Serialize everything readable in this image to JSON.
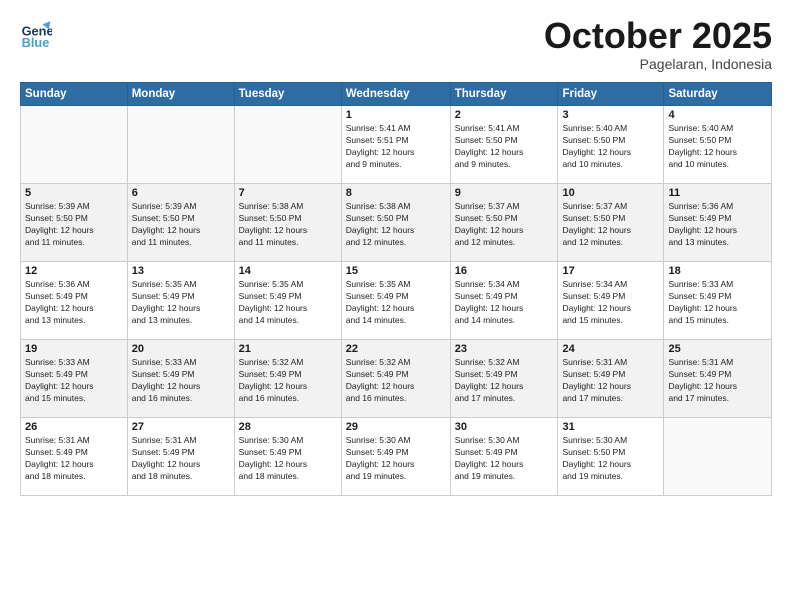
{
  "header": {
    "logo_general": "General",
    "logo_blue": "Blue",
    "month": "October 2025",
    "location": "Pagelaran, Indonesia"
  },
  "weekdays": [
    "Sunday",
    "Monday",
    "Tuesday",
    "Wednesday",
    "Thursday",
    "Friday",
    "Saturday"
  ],
  "weeks": [
    [
      {
        "day": "",
        "info": ""
      },
      {
        "day": "",
        "info": ""
      },
      {
        "day": "",
        "info": ""
      },
      {
        "day": "1",
        "info": "Sunrise: 5:41 AM\nSunset: 5:51 PM\nDaylight: 12 hours\nand 9 minutes."
      },
      {
        "day": "2",
        "info": "Sunrise: 5:41 AM\nSunset: 5:50 PM\nDaylight: 12 hours\nand 9 minutes."
      },
      {
        "day": "3",
        "info": "Sunrise: 5:40 AM\nSunset: 5:50 PM\nDaylight: 12 hours\nand 10 minutes."
      },
      {
        "day": "4",
        "info": "Sunrise: 5:40 AM\nSunset: 5:50 PM\nDaylight: 12 hours\nand 10 minutes."
      }
    ],
    [
      {
        "day": "5",
        "info": "Sunrise: 5:39 AM\nSunset: 5:50 PM\nDaylight: 12 hours\nand 11 minutes."
      },
      {
        "day": "6",
        "info": "Sunrise: 5:39 AM\nSunset: 5:50 PM\nDaylight: 12 hours\nand 11 minutes."
      },
      {
        "day": "7",
        "info": "Sunrise: 5:38 AM\nSunset: 5:50 PM\nDaylight: 12 hours\nand 11 minutes."
      },
      {
        "day": "8",
        "info": "Sunrise: 5:38 AM\nSunset: 5:50 PM\nDaylight: 12 hours\nand 12 minutes."
      },
      {
        "day": "9",
        "info": "Sunrise: 5:37 AM\nSunset: 5:50 PM\nDaylight: 12 hours\nand 12 minutes."
      },
      {
        "day": "10",
        "info": "Sunrise: 5:37 AM\nSunset: 5:50 PM\nDaylight: 12 hours\nand 12 minutes."
      },
      {
        "day": "11",
        "info": "Sunrise: 5:36 AM\nSunset: 5:49 PM\nDaylight: 12 hours\nand 13 minutes."
      }
    ],
    [
      {
        "day": "12",
        "info": "Sunrise: 5:36 AM\nSunset: 5:49 PM\nDaylight: 12 hours\nand 13 minutes."
      },
      {
        "day": "13",
        "info": "Sunrise: 5:35 AM\nSunset: 5:49 PM\nDaylight: 12 hours\nand 13 minutes."
      },
      {
        "day": "14",
        "info": "Sunrise: 5:35 AM\nSunset: 5:49 PM\nDaylight: 12 hours\nand 14 minutes."
      },
      {
        "day": "15",
        "info": "Sunrise: 5:35 AM\nSunset: 5:49 PM\nDaylight: 12 hours\nand 14 minutes."
      },
      {
        "day": "16",
        "info": "Sunrise: 5:34 AM\nSunset: 5:49 PM\nDaylight: 12 hours\nand 14 minutes."
      },
      {
        "day": "17",
        "info": "Sunrise: 5:34 AM\nSunset: 5:49 PM\nDaylight: 12 hours\nand 15 minutes."
      },
      {
        "day": "18",
        "info": "Sunrise: 5:33 AM\nSunset: 5:49 PM\nDaylight: 12 hours\nand 15 minutes."
      }
    ],
    [
      {
        "day": "19",
        "info": "Sunrise: 5:33 AM\nSunset: 5:49 PM\nDaylight: 12 hours\nand 15 minutes."
      },
      {
        "day": "20",
        "info": "Sunrise: 5:33 AM\nSunset: 5:49 PM\nDaylight: 12 hours\nand 16 minutes."
      },
      {
        "day": "21",
        "info": "Sunrise: 5:32 AM\nSunset: 5:49 PM\nDaylight: 12 hours\nand 16 minutes."
      },
      {
        "day": "22",
        "info": "Sunrise: 5:32 AM\nSunset: 5:49 PM\nDaylight: 12 hours\nand 16 minutes."
      },
      {
        "day": "23",
        "info": "Sunrise: 5:32 AM\nSunset: 5:49 PM\nDaylight: 12 hours\nand 17 minutes."
      },
      {
        "day": "24",
        "info": "Sunrise: 5:31 AM\nSunset: 5:49 PM\nDaylight: 12 hours\nand 17 minutes."
      },
      {
        "day": "25",
        "info": "Sunrise: 5:31 AM\nSunset: 5:49 PM\nDaylight: 12 hours\nand 17 minutes."
      }
    ],
    [
      {
        "day": "26",
        "info": "Sunrise: 5:31 AM\nSunset: 5:49 PM\nDaylight: 12 hours\nand 18 minutes."
      },
      {
        "day": "27",
        "info": "Sunrise: 5:31 AM\nSunset: 5:49 PM\nDaylight: 12 hours\nand 18 minutes."
      },
      {
        "day": "28",
        "info": "Sunrise: 5:30 AM\nSunset: 5:49 PM\nDaylight: 12 hours\nand 18 minutes."
      },
      {
        "day": "29",
        "info": "Sunrise: 5:30 AM\nSunset: 5:49 PM\nDaylight: 12 hours\nand 19 minutes."
      },
      {
        "day": "30",
        "info": "Sunrise: 5:30 AM\nSunset: 5:49 PM\nDaylight: 12 hours\nand 19 minutes."
      },
      {
        "day": "31",
        "info": "Sunrise: 5:30 AM\nSunset: 5:50 PM\nDaylight: 12 hours\nand 19 minutes."
      },
      {
        "day": "",
        "info": ""
      }
    ]
  ]
}
